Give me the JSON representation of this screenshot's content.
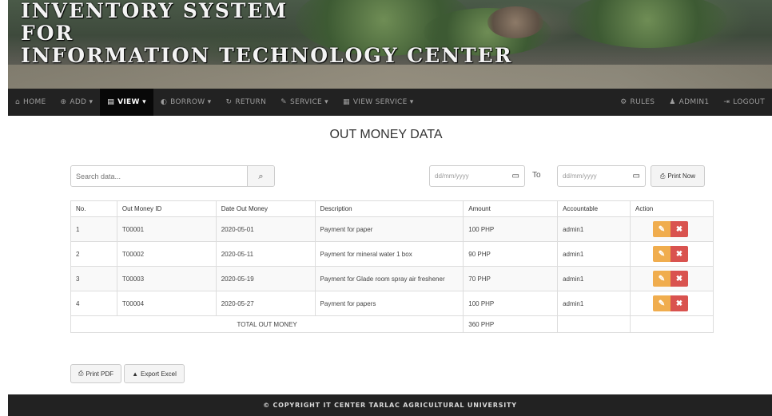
{
  "banner": {
    "title_line1": "INVENTORY SYSTEM",
    "title_line2": "FOR",
    "title_line3": "INFORMATION TECHNOLOGY CENTER"
  },
  "nav": {
    "left": [
      {
        "icon": "home-icon",
        "glyph": "⌂",
        "label": "HOME"
      },
      {
        "icon": "plus-icon",
        "glyph": "⊕",
        "label": "ADD ▾"
      },
      {
        "icon": "list-icon",
        "glyph": "▤",
        "label": "VIEW ▾"
      },
      {
        "icon": "borrow-icon",
        "glyph": "◐",
        "label": "BORROW ▾"
      },
      {
        "icon": "return-icon",
        "glyph": "↻",
        "label": "RETURN"
      },
      {
        "icon": "wrench-icon",
        "glyph": "✎",
        "label": "SERVICE ▾"
      },
      {
        "icon": "view-service-icon",
        "glyph": "▦",
        "label": "VIEW SERVICE ▾"
      }
    ],
    "right": [
      {
        "icon": "rules-icon",
        "glyph": "⚙",
        "label": "RULES"
      },
      {
        "icon": "user-icon",
        "glyph": "♟",
        "label": "ADMIN1"
      },
      {
        "icon": "logout-icon",
        "glyph": "⇥",
        "label": "LOGOUT"
      }
    ],
    "active_index": 2
  },
  "page": {
    "title": "OUT MONEY DATA"
  },
  "toolbar": {
    "search_placeholder": "Search data...",
    "search_icon": "search-icon",
    "date_placeholder": "dd/mm/yyyy",
    "to_label": "To",
    "print_now_label": "Print Now"
  },
  "table": {
    "headers": [
      "No.",
      "Out Money ID",
      "Date Out Money",
      "Description",
      "Amount",
      "Accountable",
      "Action"
    ],
    "rows": [
      [
        "1",
        "T00001",
        "2020-05-01",
        "Payment for paper",
        "100 PHP",
        "admin1"
      ],
      [
        "2",
        "T00002",
        "2020-05-11",
        "Payment for mineral water 1 box",
        "90 PHP",
        "admin1"
      ],
      [
        "3",
        "T00003",
        "2020-05-19",
        "Payment for Glade room spray air freshener",
        "70 PHP",
        "admin1"
      ],
      [
        "4",
        "T00004",
        "2020-05-27",
        "Payment for papers",
        "100 PHP",
        "admin1"
      ]
    ],
    "total_label": "TOTAL OUT MONEY",
    "total_value": "360 PHP"
  },
  "actions": {
    "print_pdf_label": "Print PDF",
    "export_excel_label": "Export Excel"
  },
  "footer": {
    "text": "© COPYRIGHT IT CENTER TARLAC AGRICULTURAL UNIVERSITY"
  },
  "colors": {
    "navbar": "#222222",
    "edit_button": "#f0ad4e",
    "delete_button": "#d9534f"
  }
}
